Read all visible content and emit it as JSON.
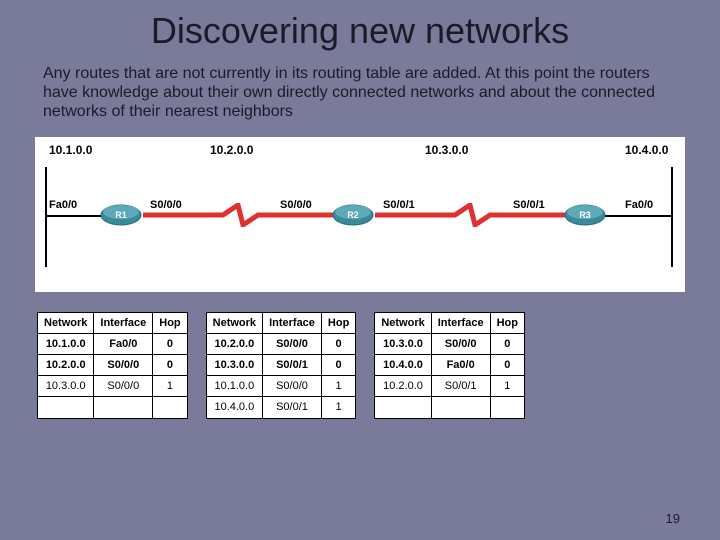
{
  "title": "Discovering new networks",
  "body": "Any routes that are not currently in its routing table are added. At this point the routers have knowledge about their own directly connected networks and about the connected networks of their nearest neighbors",
  "networks": [
    "10.1.0.0",
    "10.2.0.0",
    "10.3.0.0",
    "10.4.0.0"
  ],
  "routers": {
    "r1": {
      "label": "R1",
      "left_if": "Fa0/0",
      "right_if": "S0/0/0"
    },
    "r2": {
      "label": "R2",
      "left_if": "S0/0/0",
      "right_if": "S0/0/1"
    },
    "r3": {
      "label": "R3",
      "left_if": "S0/0/1",
      "right_if": "Fa0/0"
    }
  },
  "table_headers": [
    "Network",
    "Interface",
    "Hop"
  ],
  "tables": {
    "t1": [
      {
        "net": "10.1.0.0",
        "if": "Fa0/0",
        "hop": "0",
        "bold": true
      },
      {
        "net": "10.2.0.0",
        "if": "S0/0/0",
        "hop": "0",
        "bold": true
      },
      {
        "net": "10.3.0.0",
        "if": "S0/0/0",
        "hop": "1",
        "bold": false
      }
    ],
    "t2": [
      {
        "net": "10.2.0.0",
        "if": "S0/0/0",
        "hop": "0",
        "bold": true
      },
      {
        "net": "10.3.0.0",
        "if": "S0/0/1",
        "hop": "0",
        "bold": true
      },
      {
        "net": "10.1.0.0",
        "if": "S0/0/0",
        "hop": "1",
        "bold": false
      },
      {
        "net": "10.4.0.0",
        "if": "S0/0/1",
        "hop": "1",
        "bold": false
      }
    ],
    "t3": [
      {
        "net": "10.3.0.0",
        "if": "S0/0/0",
        "hop": "0",
        "bold": true
      },
      {
        "net": "10.4.0.0",
        "if": "Fa0/0",
        "hop": "0",
        "bold": true
      },
      {
        "net": "10.2.0.0",
        "if": "S0/0/1",
        "hop": "1",
        "bold": false
      }
    ]
  },
  "page_number": "19"
}
